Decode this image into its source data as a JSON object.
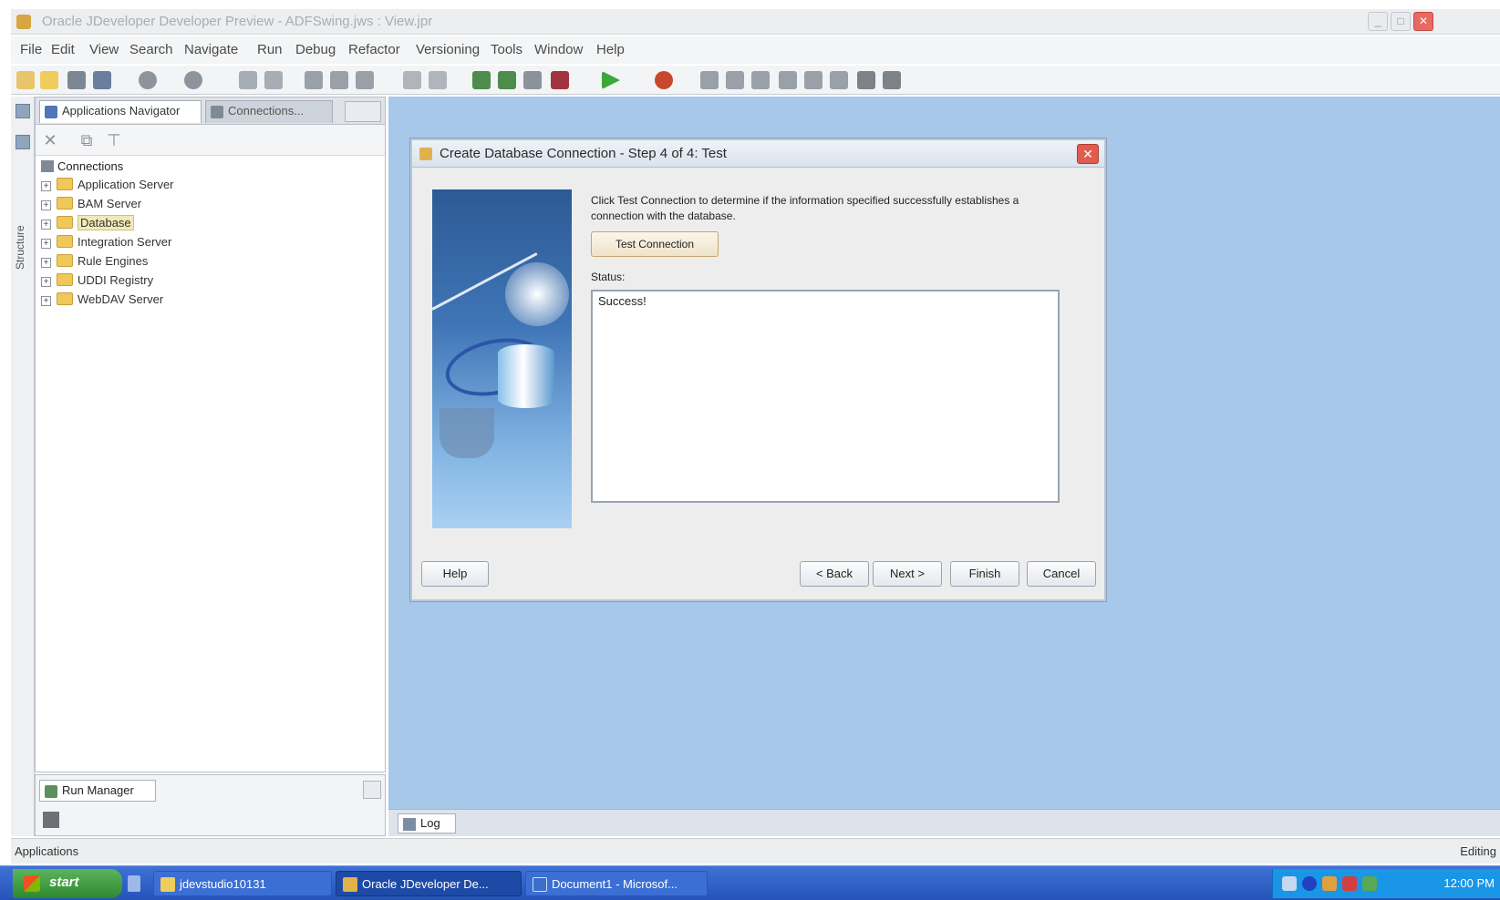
{
  "window": {
    "title": "Oracle JDeveloper Developer Preview - ADFSwing.jws : View.jpr",
    "minimize_glyph": "_",
    "maximize_glyph": "□",
    "close_glyph": "✕"
  },
  "menu": [
    "File",
    "Edit",
    "View",
    "Search",
    "Navigate",
    "Run",
    "Debug",
    "Refactor",
    "Versioning",
    "Tools",
    "Window",
    "Help"
  ],
  "side_strip": {
    "label": "Structure"
  },
  "navigator": {
    "tabs": [
      "Applications Navigator",
      "Connections..."
    ],
    "tree_root": "Connections",
    "tree_items": [
      {
        "label": "Application Server",
        "expander": "+"
      },
      {
        "label": "BAM Server",
        "expander": "+"
      },
      {
        "label": "Database",
        "expander": "+",
        "selected": true
      },
      {
        "label": "Integration Server",
        "expander": "+"
      },
      {
        "label": "Rule Engines",
        "expander": "+"
      },
      {
        "label": "UDDI Registry",
        "expander": "+"
      },
      {
        "label": "WebDAV Server",
        "expander": "+"
      }
    ]
  },
  "run_manager": {
    "tab": "Run Manager"
  },
  "log": {
    "tab": "Log"
  },
  "statusbar": {
    "left": "Applications",
    "right": "Editing"
  },
  "dialog": {
    "title": "Create Database Connection - Step 4 of 4: Test",
    "close_glyph": "✕",
    "instructions": "Click Test Connection to determine if the information specified successfully establishes a connection with the database.",
    "test_button": "Test Connection",
    "status_label": "Status:",
    "status_value": "Success!",
    "buttons": {
      "help": "Help",
      "back": "< Back",
      "next": "Next >",
      "finish": "Finish",
      "cancel": "Cancel"
    }
  },
  "taskbar": {
    "start": "start",
    "tasks": [
      "jdevstudio10131",
      "Oracle JDeveloper De...",
      "Document1 - Microsof..."
    ],
    "clock": "12:00 PM"
  },
  "colors": {
    "editor_bg": "#a8c8ea",
    "taskbar": "#2553b8",
    "start_green": "#2e8a2e"
  }
}
